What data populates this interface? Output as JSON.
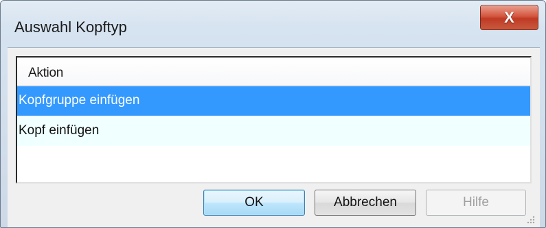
{
  "window": {
    "title": "Auswahl Kopftyp",
    "close_glyph": "X"
  },
  "list": {
    "column_header": "Aktion",
    "items": [
      {
        "label": "Kopfgruppe einfügen",
        "selected": true
      },
      {
        "label": "Kopf einfügen",
        "selected": false
      }
    ]
  },
  "buttons": {
    "ok": "OK",
    "cancel": "Abbrechen",
    "help": "Hilfe"
  },
  "colors": {
    "selection": "#3399ff",
    "alt_row": "#f0ffff",
    "close_button": "#c8452c"
  }
}
